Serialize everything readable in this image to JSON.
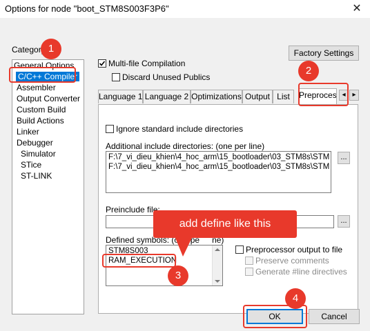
{
  "window": {
    "title": "Options for node \"boot_STM8S003F3P6\"",
    "close_glyph": "✕"
  },
  "category": {
    "label": "Category:",
    "items": [
      "General Options",
      "C/C++ Compiler",
      "Assembler",
      "Output Converter",
      "Custom Build",
      "Build Actions",
      "Linker",
      "Debugger",
      "Simulator",
      "STice",
      "ST-LINK"
    ],
    "selected_index": 1
  },
  "buttons": {
    "factory_settings": "Factory Settings",
    "ok": "OK",
    "cancel": "Cancel",
    "browse": "..."
  },
  "checks": {
    "multi_file": "Multi-file Compilation",
    "discard_unused": "Discard Unused Publics",
    "ignore_std_include": "Ignore standard include directories",
    "preprocessor_output": "Preprocessor output to file",
    "preserve_comments": "Preserve comments",
    "generate_line": "Generate #line directives"
  },
  "tabs": [
    "Language 1",
    "Language 2",
    "Optimizations",
    "Output",
    "List",
    "Preproces"
  ],
  "active_tab_index": 5,
  "scroll_glyphs": {
    "left": "◂",
    "right": "▸"
  },
  "preprocessor": {
    "include_label": "Additional include directories: (one per line)",
    "include_lines": [
      "F:\\7_vi_dieu_khien\\4_hoc_arm\\15_bootloader\\03_STM8s\\STM",
      "F:\\7_vi_dieu_khien\\4_hoc_arm\\15_bootloader\\03_STM8s\\STM"
    ],
    "preinclude_label": "Preinclude file:",
    "preinclude_value": "",
    "defined_label": "Defined symbols: (one pe",
    "defined_label_tail": "ne)",
    "defined_symbols": [
      "STM8S003",
      "RAM_EXECUTION"
    ]
  },
  "annotations": {
    "step1": "1",
    "step2": "2",
    "step3": "3",
    "step4": "4",
    "callout": "add define like this",
    "color": "#e8392b"
  },
  "colors": {
    "selection": "#0078d7",
    "dialog_bg": "#f0f0f0"
  }
}
